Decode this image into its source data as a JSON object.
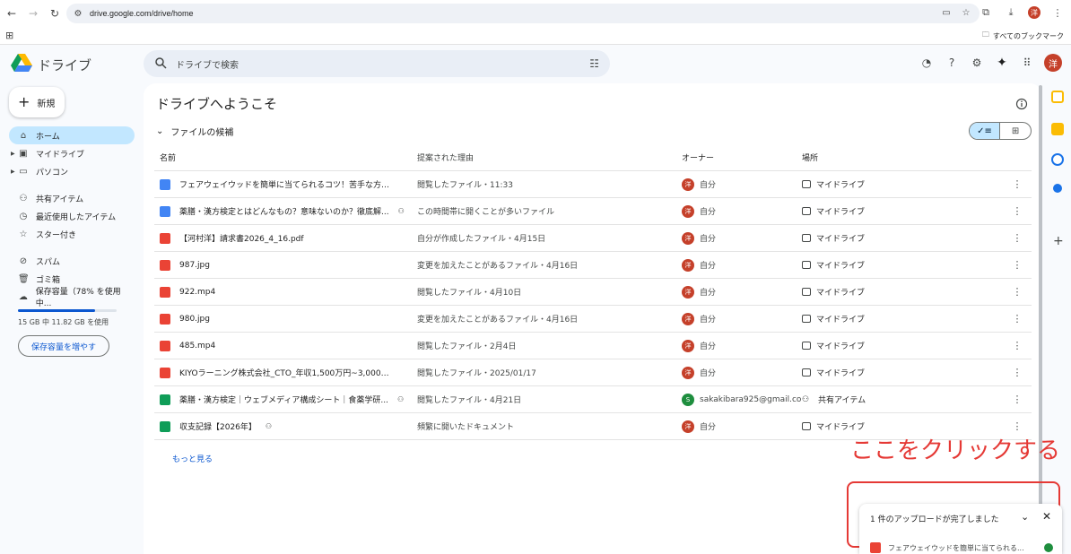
{
  "browser": {
    "url": "drive.google.com/drive/home",
    "bookmarks_label": "すべてのブックマーク",
    "profile_initial": "洋"
  },
  "header": {
    "app_name": "ドライブ",
    "search_placeholder": "ドライブで検索",
    "avatar_initial": "洋"
  },
  "sidebar": {
    "new_label": "新規",
    "items": [
      {
        "label": "ホーム"
      },
      {
        "label": "マイドライブ"
      },
      {
        "label": "パソコン"
      },
      {
        "label": "共有アイテム"
      },
      {
        "label": "最近使用したアイテム"
      },
      {
        "label": "スター付き"
      },
      {
        "label": "スパム"
      },
      {
        "label": "ゴミ箱"
      },
      {
        "label": "保存容量（78% を使用中..."
      }
    ],
    "storage_percent": 78,
    "storage_text": "15 GB 中 11.82 GB を使用",
    "more_storage_label": "保存容量を増やす"
  },
  "main": {
    "welcome": "ドライブへようこそ",
    "section_title": "ファイルの候補",
    "columns": {
      "name": "名前",
      "reason": "提案された理由",
      "owner": "オーナー",
      "location": "場所"
    },
    "rows": [
      {
        "type": "doc",
        "name": "フェアウェイウッドを簡単に当てられるコツ！苦手な方は...",
        "shared": false,
        "reason": "閲覧したファイル・11:33",
        "owner": "自分",
        "owner_initial": "洋",
        "owner_color": "red",
        "location": "マイドライブ",
        "loc_type": "drive"
      },
      {
        "type": "doc",
        "name": "薬膳・漢方検定とはどんなもの？意味ないのか？徹底解...",
        "shared": true,
        "reason": "この時間帯に開くことが多いファイル",
        "owner": "自分",
        "owner_initial": "洋",
        "owner_color": "red",
        "location": "マイドライブ",
        "loc_type": "drive"
      },
      {
        "type": "pdf",
        "name": "【河村洋】請求書2026_4_16.pdf",
        "shared": false,
        "reason": "自分が作成したファイル・4月15日",
        "owner": "自分",
        "owner_initial": "洋",
        "owner_color": "red",
        "location": "マイドライブ",
        "loc_type": "drive"
      },
      {
        "type": "img",
        "name": "987.jpg",
        "shared": false,
        "reason": "変更を加えたことがあるファイル・4月16日",
        "owner": "自分",
        "owner_initial": "洋",
        "owner_color": "red",
        "location": "マイドライブ",
        "loc_type": "drive"
      },
      {
        "type": "vid",
        "name": "922.mp4",
        "shared": false,
        "reason": "閲覧したファイル・4月10日",
        "owner": "自分",
        "owner_initial": "洋",
        "owner_color": "red",
        "location": "マイドライブ",
        "loc_type": "drive"
      },
      {
        "type": "img",
        "name": "980.jpg",
        "shared": false,
        "reason": "変更を加えたことがあるファイル・4月16日",
        "owner": "自分",
        "owner_initial": "洋",
        "owner_color": "red",
        "location": "マイドライブ",
        "loc_type": "drive"
      },
      {
        "type": "vid",
        "name": "485.mp4",
        "shared": false,
        "reason": "閲覧したファイル・2月4日",
        "owner": "自分",
        "owner_initial": "洋",
        "owner_color": "red",
        "location": "マイドライブ",
        "loc_type": "drive"
      },
      {
        "type": "pdf",
        "name": "KIYOラーニング株式会社_CTO_年収1,500万円~3,000万円...",
        "shared": false,
        "reason": "閲覧したファイル・2025/01/17",
        "owner": "自分",
        "owner_initial": "洋",
        "owner_color": "red",
        "location": "マイドライブ",
        "loc_type": "drive"
      },
      {
        "type": "sheet",
        "name": "薬膳・漢方検定｜ウェブメディア構成シート｜食薬学研...",
        "shared": true,
        "reason": "閲覧したファイル・4月21日",
        "owner": "sakakibara925@gmail.com",
        "owner_initial": "S",
        "owner_color": "green",
        "location": "共有アイテム",
        "loc_type": "shared"
      },
      {
        "type": "sheet",
        "name": "収支記録【2026年】",
        "shared": true,
        "reason": "頻繁に開いたドキュメント",
        "owner": "自分",
        "owner_initial": "洋",
        "owner_color": "red",
        "location": "マイドライブ",
        "loc_type": "drive"
      }
    ],
    "more_link": "もっと見る"
  },
  "annotation": {
    "text": "ここをクリックする"
  },
  "upload": {
    "title": "1 件のアップロードが完了しました",
    "file": "フェアウェイウッドを簡単に当てられる..."
  },
  "colors": {
    "accent": "#0b57d0",
    "active_bg": "#c2e7ff",
    "annotation": "#e53935"
  }
}
